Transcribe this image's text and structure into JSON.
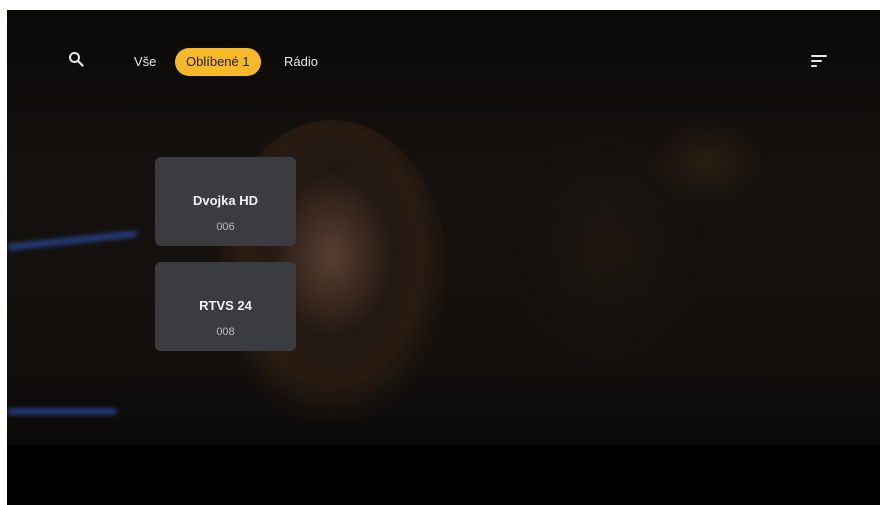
{
  "tabs": {
    "all": "Vše",
    "favorites": "Oblíbené 1",
    "radio": "Rádio",
    "active": "favorites"
  },
  "icons": {
    "search": "search-icon",
    "sort": "sort-icon"
  },
  "channels": [
    {
      "name": "Dvojka HD",
      "number": "006"
    },
    {
      "name": "RTVS 24",
      "number": "008"
    }
  ],
  "colors": {
    "accent": "#f7b928",
    "card": "#3a3c40",
    "background": "#000000"
  }
}
